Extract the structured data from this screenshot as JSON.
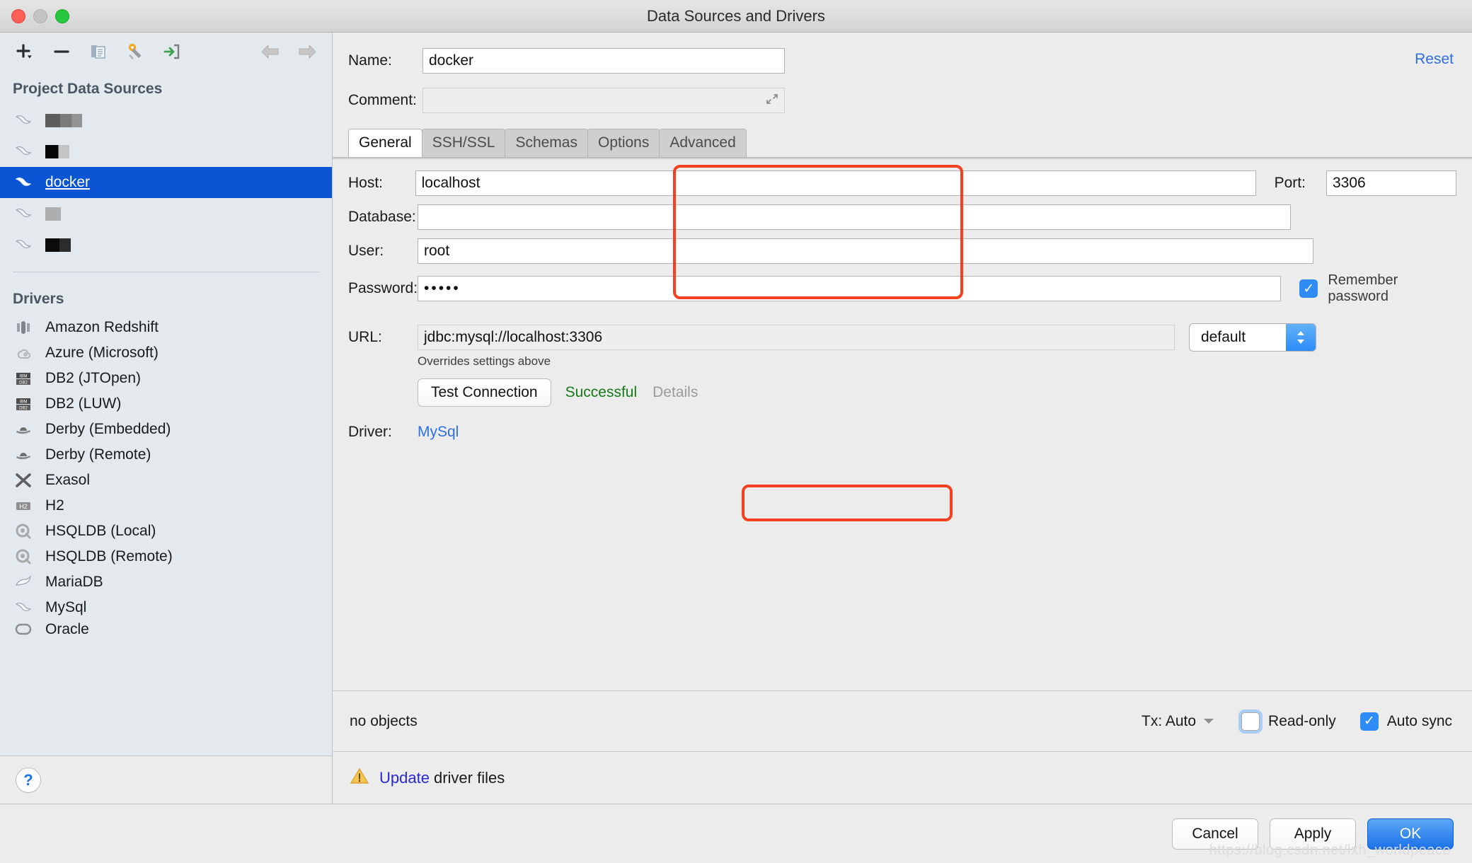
{
  "window": {
    "title": "Data Sources and Drivers",
    "traffic_lights": [
      "close-red",
      "minimize-gray",
      "zoom-green"
    ]
  },
  "sidebar": {
    "toolbar": [
      {
        "name": "add-data-source-button",
        "icon": "plus-icon",
        "glyph": "+"
      },
      {
        "name": "remove-data-source-button",
        "icon": "minus-icon",
        "glyph": "−"
      },
      {
        "name": "copy-data-source-button",
        "icon": "copy-icon",
        "glyph": "⧉"
      },
      {
        "name": "driver-properties-button",
        "icon": "wrench-icon",
        "glyph": "⚒"
      },
      {
        "name": "import-data-source-button",
        "icon": "import-arrow-icon",
        "glyph": "⇥"
      }
    ],
    "nav": [
      {
        "name": "navigate-back-button",
        "icon": "arrow-left-icon",
        "glyph": "⇦"
      },
      {
        "name": "navigate-forward-button",
        "icon": "arrow-right-icon",
        "glyph": "⇨"
      }
    ],
    "project_sources_title": "Project Data Sources",
    "data_sources": [
      {
        "label": "",
        "redacted": "a",
        "selected": false,
        "icon": "mysql-dolphin-icon"
      },
      {
        "label": "",
        "redacted": "b",
        "selected": false,
        "icon": "mysql-dolphin-icon"
      },
      {
        "label": "docker",
        "redacted": null,
        "selected": true,
        "icon": "mysql-dolphin-icon"
      },
      {
        "label": "",
        "redacted": "c",
        "selected": false,
        "icon": "mysql-dolphin-icon"
      },
      {
        "label": "",
        "redacted": "d",
        "selected": false,
        "icon": "mysql-dolphin-icon"
      }
    ],
    "drivers_title": "Drivers",
    "drivers": [
      {
        "label": "Amazon Redshift",
        "icon": "redshift-icon"
      },
      {
        "label": "Azure (Microsoft)",
        "icon": "azure-cloud-icon"
      },
      {
        "label": "DB2 (JTOpen)",
        "icon": "db2-icon"
      },
      {
        "label": "DB2 (LUW)",
        "icon": "db2-icon"
      },
      {
        "label": "Derby (Embedded)",
        "icon": "derby-hat-icon"
      },
      {
        "label": "Derby (Remote)",
        "icon": "derby-hat-icon"
      },
      {
        "label": "Exasol",
        "icon": "exasol-x-icon"
      },
      {
        "label": "H2",
        "icon": "h2-icon"
      },
      {
        "label": "HSQLDB (Local)",
        "icon": "hsqldb-icon"
      },
      {
        "label": "HSQLDB (Remote)",
        "icon": "hsqldb-icon"
      },
      {
        "label": "MariaDB",
        "icon": "mariadb-seal-icon"
      },
      {
        "label": "MySql",
        "icon": "mysql-dolphin-icon"
      },
      {
        "label": "Oracle",
        "icon": "oracle-icon"
      }
    ],
    "help_button": {
      "name": "help-button",
      "glyph": "?"
    }
  },
  "form": {
    "name_label": "Name:",
    "name_value": "docker",
    "comment_label": "Comment:",
    "comment_value": "",
    "comment_expand_icon": "expand-diagonal-icon",
    "reset_label": "Reset",
    "tabs": [
      {
        "label": "General",
        "active": true
      },
      {
        "label": "SSH/SSL",
        "active": false
      },
      {
        "label": "Schemas",
        "active": false
      },
      {
        "label": "Options",
        "active": false
      },
      {
        "label": "Advanced",
        "active": false
      }
    ],
    "host_label": "Host:",
    "host_value": "localhost",
    "port_label": "Port:",
    "port_value": "3306",
    "database_label": "Database:",
    "database_value": "",
    "user_label": "User:",
    "user_value": "root",
    "password_label": "Password:",
    "password_value": "•••••",
    "remember_password_label": "Remember password",
    "remember_password_checked": true,
    "url_label": "URL:",
    "url_value": "jdbc:mysql://localhost:3306",
    "url_hint": "Overrides settings above",
    "url_scheme_value": "default",
    "test_connection_label": "Test Connection",
    "test_connection_status": "Successful",
    "test_connection_details": "Details",
    "driver_label": "Driver:",
    "driver_value": "MySql"
  },
  "status": {
    "objects_text": "no objects",
    "tx_label": "Tx: Auto",
    "tx_dropdown_icon": "triangle-down-icon",
    "read_only_label": "Read-only",
    "read_only_checked": false,
    "auto_sync_label": "Auto sync",
    "auto_sync_checked": true
  },
  "notice": {
    "icon": "warning-triangle-icon",
    "link_text": "Update",
    "rest_text": " driver files"
  },
  "buttons": {
    "cancel": "Cancel",
    "apply": "Apply",
    "ok": "OK"
  },
  "watermark": "https://blog.csdn.net/lxh_worldpeace",
  "colors": {
    "selection_blue": "#0b55d4",
    "highlight_red": "#f4401f",
    "success_green": "#157a16",
    "link_blue": "#2f6fe0",
    "accent_blue": "#2f8bf5",
    "sidebar_bg": "#e4e9ee",
    "panel_bg": "#ececec"
  }
}
